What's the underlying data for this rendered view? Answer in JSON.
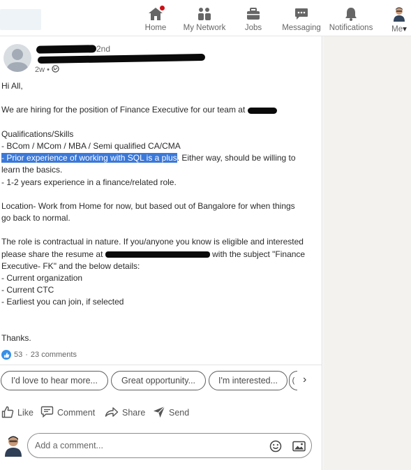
{
  "nav": {
    "items": [
      {
        "label": "Home",
        "icon": "home-icon",
        "has_badge": true
      },
      {
        "label": "My Network",
        "icon": "network-icon"
      },
      {
        "label": "Jobs",
        "icon": "briefcase-icon"
      },
      {
        "label": "Messaging",
        "icon": "messaging-icon"
      },
      {
        "label": "Notifications",
        "icon": "bell-icon"
      },
      {
        "label": "Me",
        "icon": "avatar",
        "caret": "▾"
      }
    ]
  },
  "post": {
    "author": {
      "connection_degree": "2nd",
      "time": "2w •"
    },
    "body": {
      "greeting": "Hi All,",
      "hiring_text": "We are hiring for the position of Finance Executive for our team at",
      "qual_heading": "Qualifications/Skills",
      "qual_1": "- BCom / MCom / MBA / Semi qualified CA/CMA",
      "qual_2_prefix": "- ",
      "qual_2_highlight": "Prior experience of working with SQL is a plus",
      "qual_2_suffix": ". Either way, should be willing to",
      "qual_2_cont": "learn the basics.",
      "qual_3": "- 1-2 years experience in a finance/related role.",
      "location_1": "Location- Work from Home for now, but based out of Bangalore for when things",
      "location_2": "go back to normal.",
      "role_1": "The role is contractual in nature. If you/anyone you know is eligible and interested",
      "role_2_prefix": "please share the resume at",
      "role_2_suffix": "with the subject \"Finance",
      "role_3": "Executive- FK\" and the below details:",
      "detail_1": "- Current organization",
      "detail_2": "- Current CTC",
      "detail_3": "- Earliest you can join, if selected",
      "thanks": "Thanks."
    },
    "social": {
      "reactions": "53",
      "separator": "·",
      "comments": "23 comments"
    },
    "suggestions": [
      "I'd love to hear more...",
      "Great opportunity...",
      "I'm interested...",
      "("
    ],
    "suggestions_next": "›",
    "actions": {
      "like": "Like",
      "comment": "Comment",
      "share": "Share",
      "send": "Send"
    },
    "comment_placeholder": "Add a comment..."
  },
  "colors": {
    "highlight": "#3b78d8",
    "accent_blue": "#378fe9",
    "badge_red": "#cc1016"
  }
}
